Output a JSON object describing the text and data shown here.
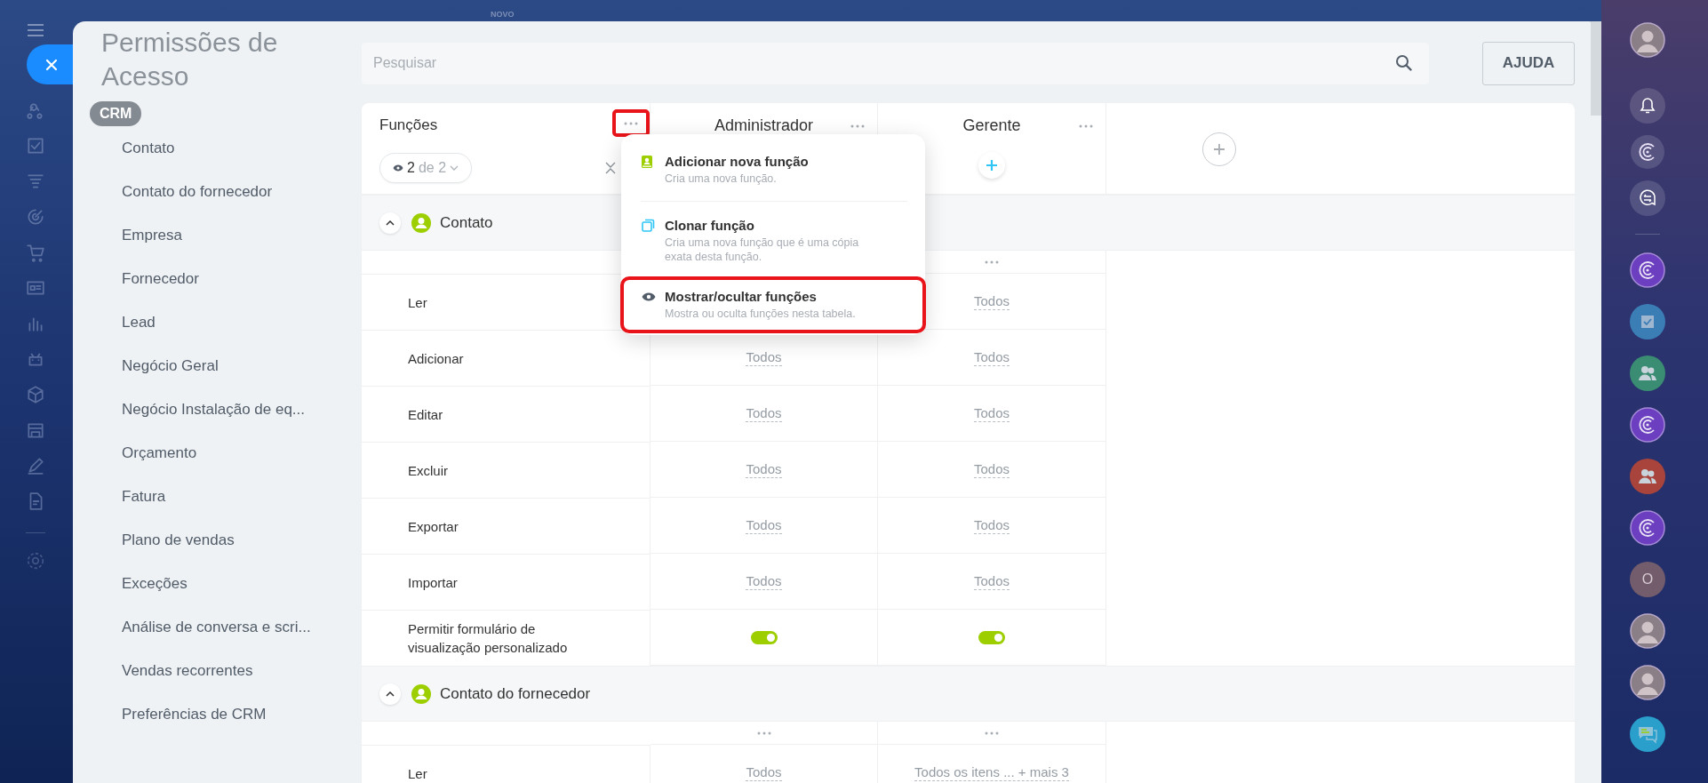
{
  "top_bar": {
    "badge": "NOVO"
  },
  "page": {
    "title": "Permissões de Acesso"
  },
  "sidebar": {
    "group": "CRM",
    "items": [
      {
        "label": "Contato"
      },
      {
        "label": "Contato do fornecedor"
      },
      {
        "label": "Empresa"
      },
      {
        "label": "Fornecedor"
      },
      {
        "label": "Lead"
      },
      {
        "label": "Negócio Geral"
      },
      {
        "label": "Negócio Instalação de eq..."
      },
      {
        "label": "Orçamento"
      },
      {
        "label": "Fatura"
      },
      {
        "label": "Plano de vendas"
      },
      {
        "label": "Exceções"
      },
      {
        "label": "Análise de conversa e scri..."
      },
      {
        "label": "Vendas recorrentes"
      },
      {
        "label": "Preferências de CRM"
      }
    ]
  },
  "search": {
    "placeholder": "Pesquisar"
  },
  "help_button": {
    "label": "AJUDA"
  },
  "table": {
    "header": "Funções",
    "menu_button_highlighted": true,
    "filter": {
      "shown": "2",
      "total": "de 2"
    },
    "roles": [
      {
        "name": "Administrador"
      },
      {
        "name": "Gerente"
      }
    ],
    "sections": [
      {
        "title": "Contato",
        "expanded": true,
        "rows": [
          {
            "label": "Ler",
            "kind": "text",
            "manager_value": "Todos"
          },
          {
            "label": "Adicionar",
            "kind": "text",
            "admin_value": "Todos",
            "manager_value": "Todos"
          },
          {
            "label": "Editar",
            "kind": "text",
            "admin_value": "Todos",
            "manager_value": "Todos"
          },
          {
            "label": "Excluir",
            "kind": "text",
            "admin_value": "Todos",
            "manager_value": "Todos"
          },
          {
            "label": "Exportar",
            "kind": "text",
            "admin_value": "Todos",
            "manager_value": "Todos"
          },
          {
            "label": "Importar",
            "kind": "text",
            "admin_value": "Todos",
            "manager_value": "Todos"
          },
          {
            "label": "Permitir formulário de visualização personalizado",
            "kind": "toggle",
            "admin_on": true,
            "manager_on": true
          }
        ]
      },
      {
        "title": "Contato do fornecedor",
        "expanded": true,
        "rows": [
          {
            "label": "Ler",
            "kind": "text",
            "admin_value": "Todos",
            "manager_value": "Todos os itens ... + mais 3"
          }
        ]
      }
    ]
  },
  "role_menu": {
    "items": [
      {
        "title": "Adicionar nova função",
        "description": "Cria uma nova função.",
        "highlighted": false
      },
      {
        "title": "Clonar função",
        "description": "Cria uma nova função que é uma cópia exata desta função.",
        "highlighted": false
      },
      {
        "title": "Mostrar/ocultar funções",
        "description": "Mostra ou oculta funções nesta tabela.",
        "highlighted": true
      }
    ]
  },
  "right_rail": {
    "items": [
      {
        "kind": "avatar"
      },
      {
        "kind": "bell"
      },
      {
        "kind": "copilot"
      },
      {
        "kind": "chat-swap"
      },
      {
        "kind": "copilot",
        "color": "#6b3fbf"
      },
      {
        "kind": "tasks",
        "color": "#3b7db5"
      },
      {
        "kind": "group",
        "color": "#3a8c72"
      },
      {
        "kind": "copilot",
        "color": "#6b3fbf"
      },
      {
        "kind": "group",
        "color": "#a8443c"
      },
      {
        "kind": "copilot",
        "color": "#6b3fbf"
      },
      {
        "kind": "letter",
        "text": "O",
        "color": "#735c6c"
      },
      {
        "kind": "avatar"
      },
      {
        "kind": "avatar"
      },
      {
        "kind": "chat",
        "color": "#2a9fcc"
      }
    ]
  }
}
